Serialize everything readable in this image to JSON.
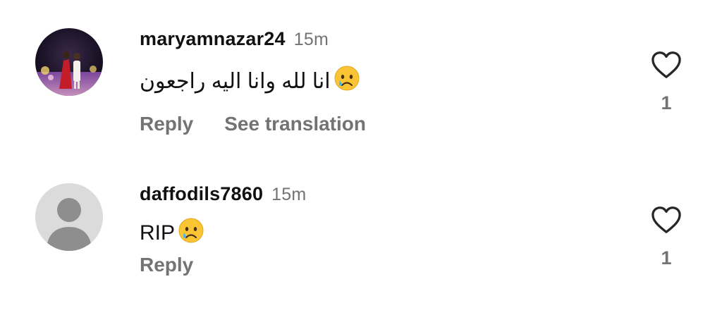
{
  "comments": [
    {
      "username": "maryamnazar24",
      "time": "15m",
      "text": "انا لله وانا اليه راجعون",
      "emoji": "crying-face-icon",
      "reply_label": "Reply",
      "translate_label": "See translation",
      "like_count": "1"
    },
    {
      "username": "daffodils7860",
      "time": "15m",
      "text": "RIP",
      "emoji": "crying-face-icon",
      "reply_label": "Reply",
      "like_count": "1"
    }
  ],
  "colors": {
    "username": "#111111",
    "meta": "#737373",
    "heart_stroke": "#262626",
    "default_avatar_bg": "#dbdbdb",
    "default_avatar_fg": "#8e8e8e"
  }
}
